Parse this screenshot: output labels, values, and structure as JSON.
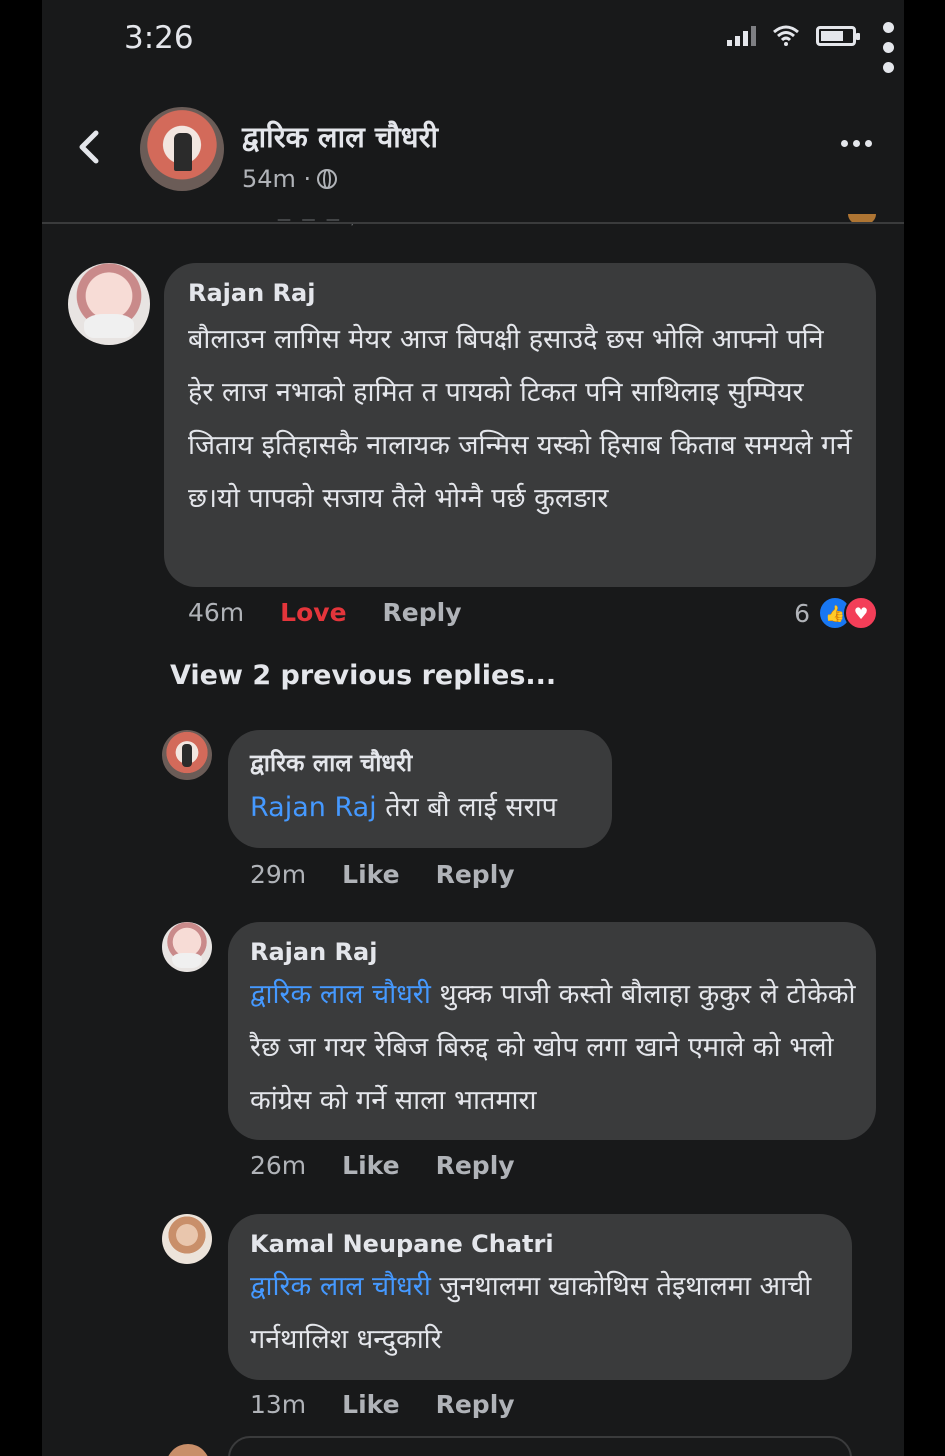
{
  "status_bar": {
    "time": "3:26"
  },
  "post_header": {
    "author": "द्वारिक लाल चौधरी",
    "time": "54m ·"
  },
  "comment": {
    "author": "Rajan Raj",
    "text": "बौलाउन लागिस मेयर आज बिपक्षी हसाउदै छस भोलि आफ्नो पनि हेर लाज नभाको हामित त पायको टिकत पनि साथिलाइ सुम्पियर जिताय इतिहासकै नालायक जन्मिस यस्को हिसाब किताब समयले गर्ने छ।यो पापको सजाय तैले भोग्नै पर्छ कुलङार",
    "time": "46m",
    "reaction_label": "Love",
    "reply_label": "Reply",
    "reaction_count": "6"
  },
  "view_previous": "View 2 previous replies...",
  "replies": [
    {
      "author": "द्वारिक लाल चौधरी",
      "mention": "Rajan Raj",
      "text": " तेरा बौ लाई सराप",
      "time": "29m",
      "like_label": "Like",
      "reply_label": "Reply"
    },
    {
      "author": "Rajan Raj",
      "mention": "द्वारिक लाल चौधरी",
      "text": " थुक्क पाजी कस्तो बौलाहा कुकुर ले टोकेको रैछ जा गयर रेबिज बिरुद्द को खोप लगा खाने एमाले को भलो कांग्रेस को गर्ने साला भातमारा",
      "time": "26m",
      "like_label": "Like",
      "reply_label": "Reply"
    },
    {
      "author": "Kamal Neupane Chatri",
      "mention": "द्वारिक लाल चौधरी",
      "text": " जुनथालमा खाकोथिस तेइथालमा आची गर्नथालिश धन्दुकारि",
      "time": "13m",
      "like_label": "Like",
      "reply_label": "Reply"
    }
  ],
  "colors": {
    "background": "#18191a",
    "bubble": "#3a3b3c",
    "mention": "#4599ff",
    "love": "#e4353b",
    "muted": "#b0b3b8"
  },
  "icons": [
    "back-arrow-icon",
    "globe-icon",
    "more-icon",
    "like-reaction-icon",
    "love-reaction-icon"
  ]
}
